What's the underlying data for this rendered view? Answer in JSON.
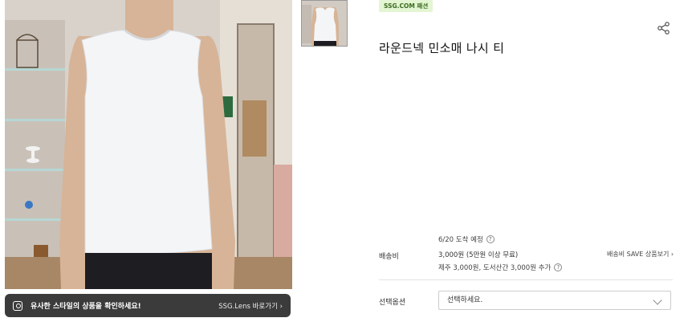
{
  "product": {
    "brand_badge": "SSG.COM 패션",
    "title": "라운드넥 민소매 나시 티",
    "main_image_alt": "white sleeveless top on mannequin",
    "thumbnail_alt": "product thumbnail"
  },
  "lens_bar": {
    "message": "유사한 스타일의 상품을 확인하세요!",
    "link": "SSG.Lens 바로가기 ›"
  },
  "shipping": {
    "label": "배송비",
    "date": "6/20 도착 예정",
    "fee": "3,000원 (5만원 이상 무료)",
    "extra": "제주 3,000원, 도서산간 3,000원 추가",
    "save_link": "배송비 SAVE 상품보기 ›"
  },
  "option": {
    "label": "선택옵션",
    "placeholder": "선택하세요."
  },
  "icons": {
    "share": "share-icon",
    "help": "question-circle-icon",
    "lens": "camera-lens-icon",
    "dropdown": "chevron-down-icon"
  },
  "colors": {
    "badge_bg": "#e3f5d3",
    "badge_text": "#3b6b1f",
    "lens_bar_bg": "#3b3b3b"
  }
}
